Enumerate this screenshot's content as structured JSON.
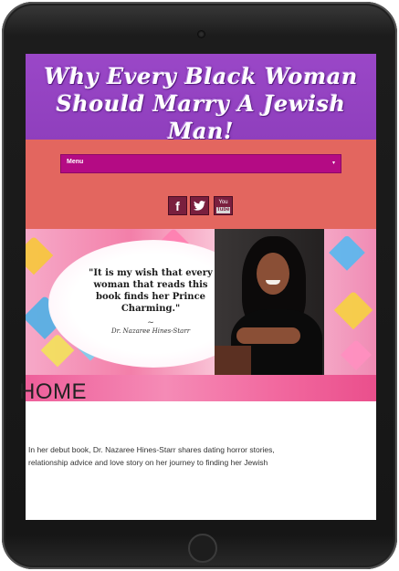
{
  "site": {
    "title": "Why Every Black Woman Should Marry A Jewish Man!"
  },
  "nav": {
    "menu_label": "Menu",
    "menu_arrow": "▾"
  },
  "social": {
    "facebook": "f",
    "twitter": "🐦",
    "youtube_top": "You",
    "youtube_bottom": "Tube"
  },
  "banner": {
    "quote_line": "\"It is my wish that every woman that reads this book finds her Prince Charming.\"",
    "tilde": "~",
    "author": "Dr. Nazaree Hines-Starr"
  },
  "page": {
    "heading": "HOME",
    "body": "In her debut book, Dr. Nazaree Hines-Starr shares dating horror stories, relationship advice and love story on her journey to finding her Jewish"
  },
  "colors": {
    "title_band": "#9a47c7",
    "coral": "#e3665f",
    "menu": "#b40b84",
    "social_icon": "#7a1f3e"
  }
}
